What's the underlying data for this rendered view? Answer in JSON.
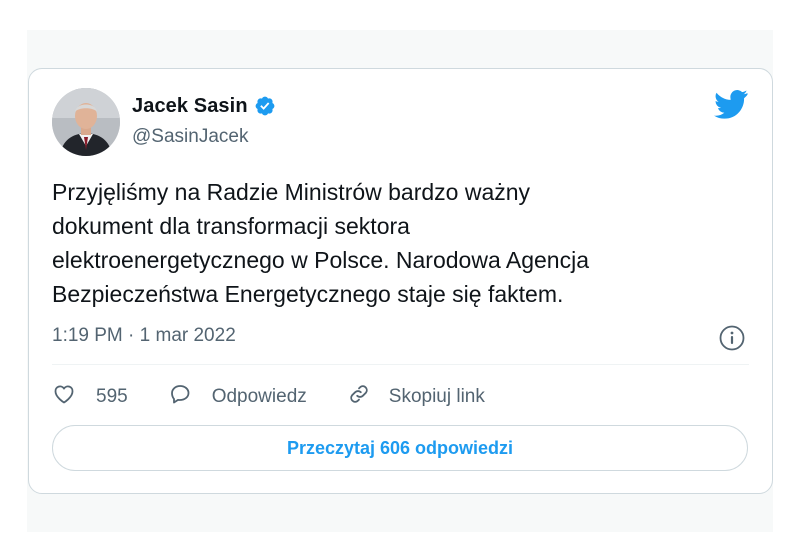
{
  "author": {
    "name": "Jacek Sasin",
    "handle": "@SasinJacek",
    "verified": true
  },
  "tweet": {
    "text": "Przyjęliśmy na Radzie Ministrów bardzo ważny\ndokument dla transformacji sektora\nelektroenergetycznego w Polsce. Narodowa Agencja\nBezpieczeństwa Energetycznego staje się faktem.",
    "timestamp": "1:19 PM · 1 mar 2022"
  },
  "actions": {
    "like_count": "595",
    "reply_label": "Odpowiedz",
    "copy_label": "Skopiuj link"
  },
  "read_replies_label": "Przeczytaj 606 odpowiedzi",
  "icons": {
    "brand": "twitter-bird-icon",
    "verified": "verified-badge-icon",
    "info": "info-icon",
    "like": "heart-icon",
    "reply": "speech-bubble-icon",
    "copy": "link-icon"
  },
  "colors": {
    "accent": "#1d9bf0",
    "text": "#0f1419",
    "muted": "#536471",
    "border": "#cfd9de"
  }
}
